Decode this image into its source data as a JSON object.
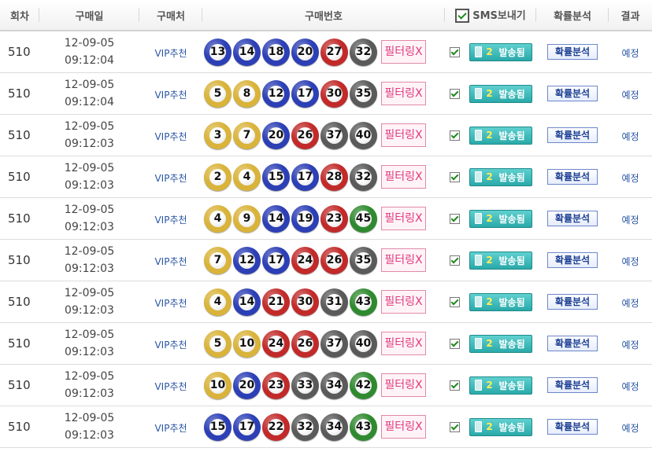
{
  "header": {
    "round": "회차",
    "date": "구매일",
    "shop": "구매처",
    "numbers": "구매번호",
    "sms": "SMS보내기",
    "prob": "확률분석",
    "result": "결과"
  },
  "colors": {
    "yellow": "#d9b33a",
    "blue": "#2c3fb5",
    "red": "#c22a2a",
    "gray": "#5a5a5a",
    "green": "#2f8a2f"
  },
  "row_labels": {
    "filter": "필터링X",
    "sms_count": "2",
    "sms_send": "발송됨",
    "prob_button": "확률분석",
    "result": "예정"
  },
  "rows": [
    {
      "round": "510",
      "date": "12-09-05",
      "time": "09:12:04",
      "shop": "VIP추천",
      "numbers": [
        13,
        14,
        18,
        20,
        27,
        32
      ]
    },
    {
      "round": "510",
      "date": "12-09-05",
      "time": "09:12:04",
      "shop": "VIP추천",
      "numbers": [
        5,
        8,
        12,
        17,
        30,
        35
      ]
    },
    {
      "round": "510",
      "date": "12-09-05",
      "time": "09:12:03",
      "shop": "VIP추천",
      "numbers": [
        3,
        7,
        20,
        26,
        37,
        40
      ]
    },
    {
      "round": "510",
      "date": "12-09-05",
      "time": "09:12:03",
      "shop": "VIP추천",
      "numbers": [
        2,
        4,
        15,
        17,
        28,
        32
      ]
    },
    {
      "round": "510",
      "date": "12-09-05",
      "time": "09:12:03",
      "shop": "VIP추천",
      "numbers": [
        4,
        9,
        14,
        19,
        23,
        45
      ]
    },
    {
      "round": "510",
      "date": "12-09-05",
      "time": "09:12:03",
      "shop": "VIP추천",
      "numbers": [
        7,
        12,
        17,
        24,
        26,
        35
      ]
    },
    {
      "round": "510",
      "date": "12-09-05",
      "time": "09:12:03",
      "shop": "VIP추천",
      "numbers": [
        4,
        14,
        21,
        30,
        31,
        43
      ]
    },
    {
      "round": "510",
      "date": "12-09-05",
      "time": "09:12:03",
      "shop": "VIP추천",
      "numbers": [
        5,
        10,
        24,
        26,
        37,
        40
      ]
    },
    {
      "round": "510",
      "date": "12-09-05",
      "time": "09:12:03",
      "shop": "VIP추천",
      "numbers": [
        10,
        20,
        23,
        33,
        34,
        42
      ]
    },
    {
      "round": "510",
      "date": "12-09-05",
      "time": "09:12:03",
      "shop": "VIP추천",
      "numbers": [
        15,
        17,
        22,
        32,
        34,
        43
      ]
    }
  ]
}
